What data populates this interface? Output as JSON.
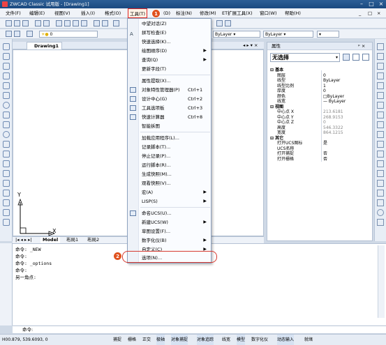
{
  "window": {
    "title": "ZWCAD Classic 试用版 - [Drawing1]"
  },
  "menubar": {
    "items": [
      "文件(F)",
      "编辑(E)",
      "视图(V)",
      "插入(I)",
      "格式(O)",
      "工具(T)",
      "(D)",
      "标注(N)",
      "修改(M)",
      "ET扩展工具(X)",
      "窗口(W)",
      "帮助(H)"
    ]
  },
  "toolbar": {
    "layer_current": "0",
    "color_dd": "ByLayer",
    "linetype_dd": "ByLayer"
  },
  "drawing": {
    "tab": "Drawing1",
    "axis_y": "Y",
    "axis_x": "X",
    "layout_tabs": [
      "Model",
      "布局1",
      "布局2"
    ]
  },
  "props": {
    "header": "属性",
    "selection": "无选择",
    "sections": [
      {
        "title": "基本",
        "rows": [
          {
            "k": "图层",
            "v": "0"
          },
          {
            "k": "线型",
            "v": "ByLayer"
          },
          {
            "k": "线型比例",
            "v": "1"
          },
          {
            "k": "厚度",
            "v": "0"
          },
          {
            "k": "颜色",
            "v": "□ByLayer"
          },
          {
            "k": "线宽",
            "v": "— ByLayer"
          }
        ]
      },
      {
        "title": "视图",
        "rows": [
          {
            "k": "中心点 X",
            "v": "213.6181"
          },
          {
            "k": "中心点 Y",
            "v": "268.9153"
          },
          {
            "k": "中心点 Z",
            "v": "0"
          },
          {
            "k": "高度",
            "v": "546.3322"
          },
          {
            "k": "宽度",
            "v": "864.1215"
          }
        ]
      },
      {
        "title": "其它",
        "rows": [
          {
            "k": "打开UCS图标",
            "v": "是"
          },
          {
            "k": "UCS名称",
            "v": ""
          },
          {
            "k": "打开捕捉",
            "v": "否"
          },
          {
            "k": "打开栅格",
            "v": "否"
          }
        ]
      }
    ]
  },
  "tools_menu": {
    "items": [
      {
        "label": "中望对话(Z)",
        "shortcut": "",
        "arrow": false
      },
      {
        "label": "拼写检查(E)",
        "shortcut": "",
        "arrow": false
      },
      {
        "label": "快速选择(K)...",
        "shortcut": "",
        "arrow": false
      },
      {
        "label": "绘图顺序(D)",
        "shortcut": "",
        "arrow": true
      },
      {
        "label": "查询(Q)",
        "shortcut": "",
        "arrow": true
      },
      {
        "label": "更新字段(T)",
        "shortcut": "",
        "arrow": false
      },
      {
        "label": "属性提取(X)...",
        "shortcut": "",
        "arrow": false
      },
      {
        "label": "对象特性管理器(P)",
        "shortcut": "Ctrl+1",
        "arrow": false
      },
      {
        "label": "设计中心(G)",
        "shortcut": "Ctrl+2",
        "arrow": false
      },
      {
        "label": "工具选项板",
        "shortcut": "Ctrl+3",
        "arrow": false
      },
      {
        "label": "快速计算器",
        "shortcut": "Ctrl+8",
        "arrow": false
      },
      {
        "label": "智能拆图",
        "shortcut": "",
        "arrow": false
      },
      {
        "label": "加载应用程序(L)...",
        "shortcut": "",
        "arrow": false
      },
      {
        "label": "记录脚本(T)...",
        "shortcut": "",
        "arrow": false
      },
      {
        "label": "停止记录(P)...",
        "shortcut": "",
        "arrow": false
      },
      {
        "label": "运行脚本(R)...",
        "shortcut": "",
        "arrow": false
      },
      {
        "label": "生成快照(M)...",
        "shortcut": "",
        "arrow": false
      },
      {
        "label": "观看快照(V)...",
        "shortcut": "",
        "arrow": false
      },
      {
        "label": "宏(A)",
        "shortcut": "",
        "arrow": true
      },
      {
        "label": "LISP(S)",
        "shortcut": "",
        "arrow": true
      },
      {
        "label": "命名UCS(U)...",
        "shortcut": "",
        "arrow": false
      },
      {
        "label": "新建UCS(W)",
        "shortcut": "",
        "arrow": true
      },
      {
        "label": "草图设置(F)...",
        "shortcut": "",
        "arrow": false
      },
      {
        "label": "数字化仪(B)",
        "shortcut": "",
        "arrow": true
      },
      {
        "label": "自定义(C)",
        "shortcut": "",
        "arrow": true
      },
      {
        "label": "选项(N)...",
        "shortcut": "",
        "arrow": false
      }
    ]
  },
  "annotations": {
    "badge1": "1",
    "badge2": "2"
  },
  "command": {
    "lines": [
      "命令: _NEW",
      "命令:",
      "命令: _options",
      "命令:",
      "另一角点:"
    ],
    "prompt": "命令:"
  },
  "status": {
    "coords": "H00.879, 539.6093, 0",
    "buttons": [
      "捕捉",
      "栅格",
      "正交",
      "极轴",
      "对象捕捉",
      "对象追踪",
      "线宽",
      "模型",
      "数字化仪",
      "动态输入",
      "就绪"
    ]
  }
}
